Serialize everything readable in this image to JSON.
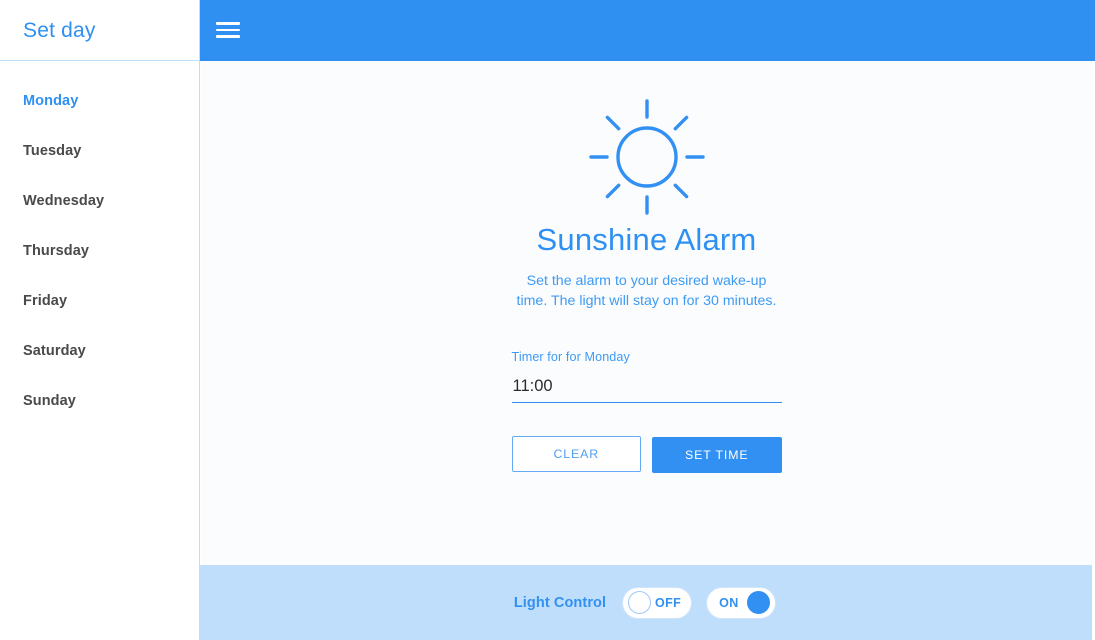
{
  "sidebar": {
    "title": "Set day",
    "items": [
      {
        "label": "Monday",
        "active": true
      },
      {
        "label": "Tuesday",
        "active": false
      },
      {
        "label": "Wednesday",
        "active": false
      },
      {
        "label": "Thursday",
        "active": false
      },
      {
        "label": "Friday",
        "active": false
      },
      {
        "label": "Saturday",
        "active": false
      },
      {
        "label": "Sunday",
        "active": false
      }
    ]
  },
  "appbar": {
    "menu_icon": "hamburger-menu-icon"
  },
  "main": {
    "icon": "sun-icon",
    "title": "Sunshine Alarm",
    "subtitle": "Set the alarm to your desired wake-up time. The light will stay on for 30 minutes.",
    "field_label": "Timer for for Monday",
    "time_value": "11:00",
    "time_placeholder": "",
    "clear_label": "CLEAR",
    "set_time_label": "SET TIME"
  },
  "footer": {
    "label": "Light Control",
    "toggle_off_label": "OFF",
    "toggle_on_label": "ON",
    "active_state": "ON"
  },
  "colors": {
    "brand_blue": "#2f90f2",
    "light_blue_bar": "#bfdefb",
    "text_blue": "#3d9bf5",
    "day_text": "#4a4a4a",
    "content_bg": "#fbfcfe"
  }
}
